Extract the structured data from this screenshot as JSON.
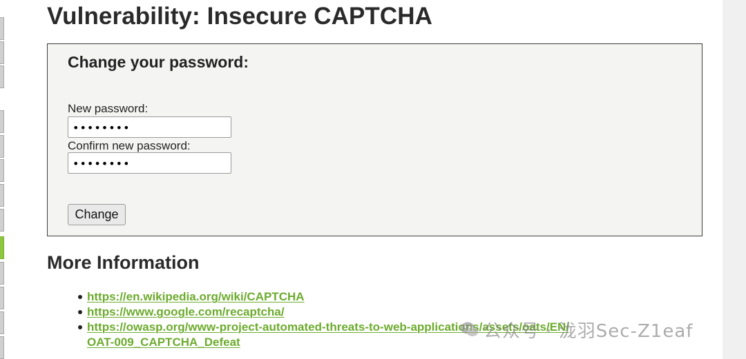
{
  "page": {
    "title": "Vulnerability: Insecure CAPTCHA"
  },
  "sidebar": {
    "active_color": "#8ec63f"
  },
  "form": {
    "heading": "Change your password:",
    "new_password_label": "New password:",
    "new_password_value": "••••••••",
    "confirm_password_label": "Confirm new password:",
    "confirm_password_value": "••••••••",
    "change_button_label": "Change"
  },
  "more_info": {
    "heading": "More Information",
    "links": [
      {
        "text": "https://en.wikipedia.org/wiki/CAPTCHA"
      },
      {
        "text": "https://www.google.com/recaptcha/"
      },
      {
        "text_line1": "https://owasp.org/www-project-automated-threats-to-web-applications/assets/oats/EN/",
        "text_line2": "OAT-009_CAPTCHA_Defeat"
      }
    ]
  },
  "watermark": {
    "text": "公众号 · 泷羽Sec-Z1eaf",
    "icon": "wechat-icon"
  },
  "colors": {
    "link": "#6cab2d",
    "title": "#2a2a2a",
    "box_background": "#f4f5f3"
  }
}
